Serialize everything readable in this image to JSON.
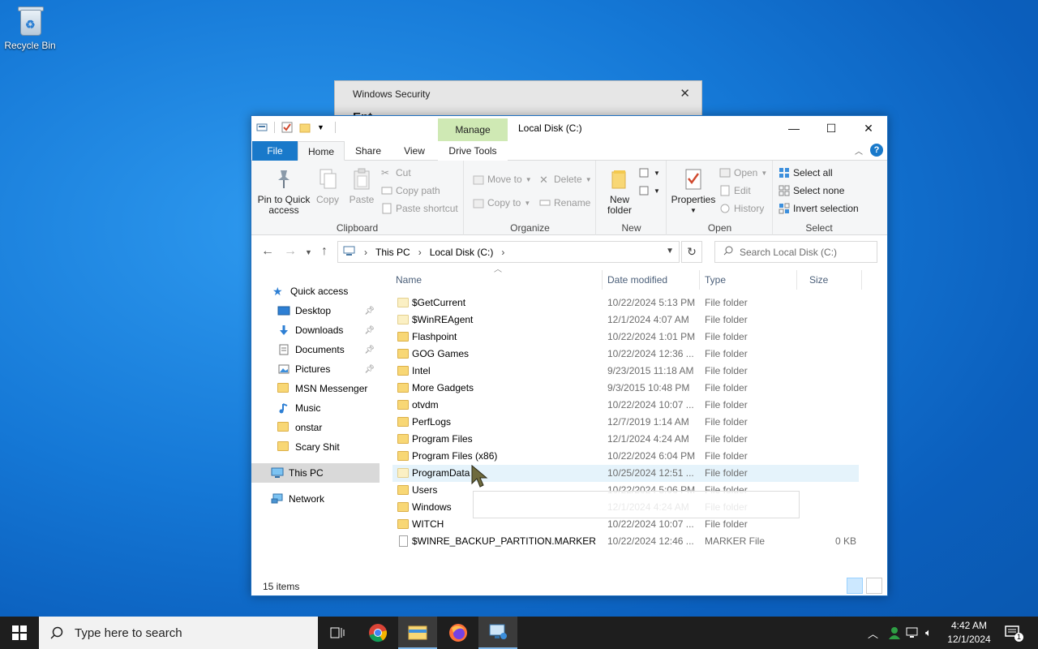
{
  "desktop": {
    "recycle_bin_label": "Recycle Bin"
  },
  "windows_security": {
    "title": "Windows Security",
    "close": "✕",
    "subtitle": "Ent"
  },
  "explorer": {
    "title": "Local Disk (C:)",
    "manage_tab": "Manage",
    "caption": {
      "minimize": "—",
      "maximize": "☐",
      "close": "✕"
    },
    "tabs": {
      "file": "File",
      "home": "Home",
      "share": "Share",
      "view": "View",
      "drive_tools": "Drive Tools"
    },
    "ribbon": {
      "clipboard": {
        "label": "Clipboard",
        "pin_to_quick_access": [
          "Pin to Quick",
          "access"
        ],
        "copy": "Copy",
        "paste": "Paste",
        "cut": "Cut",
        "copy_path": "Copy path",
        "paste_shortcut": "Paste shortcut"
      },
      "organize": {
        "label": "Organize",
        "move_to": "Move to",
        "copy_to": "Copy to",
        "delete": "Delete",
        "rename": "Rename"
      },
      "new": {
        "label": "New",
        "new_folder": [
          "New",
          "folder"
        ]
      },
      "open": {
        "label": "Open",
        "properties": "Properties",
        "open": "Open",
        "edit": "Edit",
        "history": "History"
      },
      "select": {
        "label": "Select",
        "select_all": "Select all",
        "select_none": "Select none",
        "invert_selection": "Invert selection"
      }
    },
    "address": {
      "crumbs": [
        "This PC",
        "Local Disk (C:)"
      ],
      "search_placeholder": "Search Local Disk (C:)"
    },
    "nav_pane": {
      "quick_access": "Quick access",
      "items": [
        {
          "label": "Desktop",
          "pinned": true
        },
        {
          "label": "Downloads",
          "pinned": true
        },
        {
          "label": "Documents",
          "pinned": true
        },
        {
          "label": "Pictures",
          "pinned": true
        },
        {
          "label": "MSN Messenger",
          "pinned": false
        },
        {
          "label": "Music",
          "pinned": false
        },
        {
          "label": "onstar",
          "pinned": false
        },
        {
          "label": "Scary Shit",
          "pinned": false
        }
      ],
      "this_pc": "This PC",
      "network": "Network"
    },
    "columns": {
      "name": "Name",
      "date_modified": "Date modified",
      "type": "Type",
      "size": "Size"
    },
    "files": [
      {
        "name": "$GetCurrent",
        "date": "10/22/2024 5:13 PM",
        "type": "File folder",
        "size": "",
        "kind": "folder-pale"
      },
      {
        "name": "$WinREAgent",
        "date": "12/1/2024 4:07 AM",
        "type": "File folder",
        "size": "",
        "kind": "folder-pale"
      },
      {
        "name": "Flashpoint",
        "date": "10/22/2024 1:01 PM",
        "type": "File folder",
        "size": "",
        "kind": "folder"
      },
      {
        "name": "GOG Games",
        "date": "10/22/2024 12:36 ...",
        "type": "File folder",
        "size": "",
        "kind": "folder"
      },
      {
        "name": "Intel",
        "date": "9/23/2015 11:18 AM",
        "type": "File folder",
        "size": "",
        "kind": "folder"
      },
      {
        "name": "More Gadgets",
        "date": "9/3/2015 10:48 PM",
        "type": "File folder",
        "size": "",
        "kind": "folder"
      },
      {
        "name": "otvdm",
        "date": "10/22/2024 10:07 ...",
        "type": "File folder",
        "size": "",
        "kind": "folder"
      },
      {
        "name": "PerfLogs",
        "date": "12/7/2019 1:14 AM",
        "type": "File folder",
        "size": "",
        "kind": "folder"
      },
      {
        "name": "Program Files",
        "date": "12/1/2024 4:24 AM",
        "type": "File folder",
        "size": "",
        "kind": "folder"
      },
      {
        "name": "Program Files (x86)",
        "date": "10/22/2024 6:04 PM",
        "type": "File folder",
        "size": "",
        "kind": "folder"
      },
      {
        "name": "ProgramData",
        "date": "10/25/2024 12:51 ...",
        "type": "File folder",
        "size": "",
        "kind": "folder-pale"
      },
      {
        "name": "Users",
        "date": "10/22/2024 5:06 PM",
        "type": "File folder",
        "size": "",
        "kind": "folder"
      },
      {
        "name": "Windows",
        "date": "12/1/2024 4:24 AM",
        "type": "File folder",
        "size": "",
        "kind": "folder"
      },
      {
        "name": "WITCH",
        "date": "10/22/2024 10:07 ...",
        "type": "File folder",
        "size": "",
        "kind": "folder"
      },
      {
        "name": "$WINRE_BACKUP_PARTITION.MARKER",
        "date": "10/22/2024 12:46 ...",
        "type": "MARKER File",
        "size": "0 KB",
        "kind": "file"
      }
    ],
    "hovered_row": 10,
    "status": "15 items"
  },
  "taskbar": {
    "search_placeholder": "Type here to search",
    "time": "4:42 AM",
    "date": "12/1/2024",
    "notification_count": "1"
  },
  "colors": {
    "accent": "#1979ca",
    "manage_tab": "#cfe9b4",
    "folder": "#f8d775",
    "hover_row": "#e5f3fb"
  }
}
